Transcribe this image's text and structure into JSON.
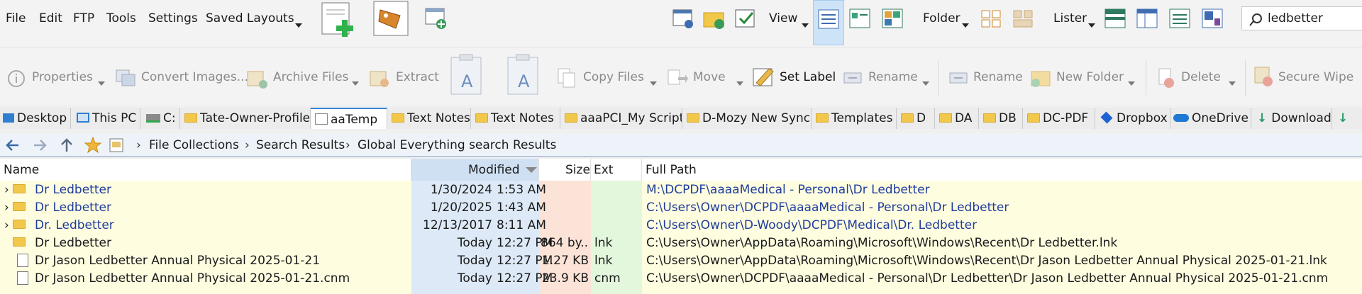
{
  "menubar": {
    "items": [
      "File",
      "Edit",
      "FTP",
      "Tools",
      "Settings",
      "Saved Layouts"
    ],
    "view_label": "View",
    "folder_label": "Folder",
    "lister_label": "Lister",
    "search_value": "ledbetter"
  },
  "toolbar": {
    "properties": "Properties",
    "convert_images": "Convert Images...",
    "archive_files": "Archive Files",
    "extract": "Extract",
    "copy_files": "Copy Files",
    "move": "Move",
    "set_label": "Set Label",
    "rename1": "Rename",
    "rename2": "Rename",
    "new_folder": "New Folder",
    "delete": "Delete",
    "secure_wipe": "Secure Wipe"
  },
  "tabs": [
    {
      "label": "Desktop"
    },
    {
      "label": "This PC"
    },
    {
      "label": "C:"
    },
    {
      "label": "Tate-Owner-Profile"
    },
    {
      "label": "aaTemp"
    },
    {
      "label": "Text Notes"
    },
    {
      "label": "Text Notes"
    },
    {
      "label": "aaaPCI_My Script"
    },
    {
      "label": "D-Mozy New Sync"
    },
    {
      "label": "Templates"
    },
    {
      "label": "D"
    },
    {
      "label": "DA"
    },
    {
      "label": "DB"
    },
    {
      "label": "DC-PDF"
    },
    {
      "label": "Dropbox"
    },
    {
      "label": "OneDrive"
    },
    {
      "label": "Download"
    }
  ],
  "breadcrumb": [
    "File Collections",
    "Search Results",
    "Global Everything search Results"
  ],
  "columns": {
    "name": "Name",
    "modified": "Modified",
    "size": "Size",
    "ext": "Ext",
    "full_path": "Full Path"
  },
  "rows": [
    {
      "name": "Dr Ledbetter",
      "date": "1/30/2024",
      "time": "1:53 AM",
      "size": "",
      "ext": "",
      "path": "M:\\DCPDF\\aaaaMedical - Personal\\Dr Ledbetter"
    },
    {
      "name": "Dr Ledbetter",
      "date": "1/20/2025",
      "time": "1:43 AM",
      "size": "",
      "ext": "",
      "path": "C:\\Users\\Owner\\DCPDF\\aaaaMedical - Personal\\Dr Ledbetter"
    },
    {
      "name": "Dr. Ledbetter",
      "date": "12/13/2017",
      "time": "8:11 AM",
      "size": "",
      "ext": "",
      "path": "C:\\Users\\Owner\\D-Woody\\DCPDF\\Medical\\Dr. Ledbetter"
    },
    {
      "name": "Dr Ledbetter",
      "date": "Today",
      "time": "12:27 PM",
      "size": "864 by...",
      "ext": "lnk",
      "path": "C:\\Users\\Owner\\AppData\\Roaming\\Microsoft\\Windows\\Recent\\Dr Ledbetter.lnk"
    },
    {
      "name": "Dr Jason Ledbetter Annual Physical 2025-01-21",
      "date": "Today",
      "time": "12:27 PM",
      "size": "1.27 KB",
      "ext": "lnk",
      "path": "C:\\Users\\Owner\\AppData\\Roaming\\Microsoft\\Windows\\Recent\\Dr Jason Ledbetter Annual Physical 2025-01-21.lnk"
    },
    {
      "name": "Dr Jason Ledbetter Annual Physical 2025-01-21.cnm",
      "date": "Today",
      "time": "12:27 PM",
      "size": "23.9 KB",
      "ext": "cnm",
      "path": "C:\\Users\\Owner\\DCPDF\\aaaaMedical - Personal\\Dr Ledbetter\\Dr Jason Ledbetter Annual Physical 2025-01-21.cnm"
    }
  ],
  "colors": {
    "folder_link": "#1f3d9c",
    "row_bg": "#fffde0",
    "modified_bg": "#dde9f7",
    "size_bg": "#fbe3d8",
    "ext_bg": "#e3f7dc"
  }
}
